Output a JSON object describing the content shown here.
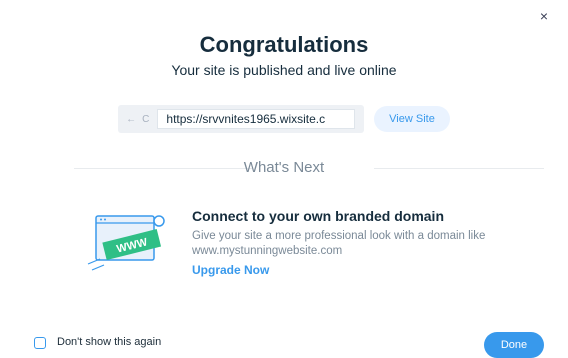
{
  "dialog": {
    "close_glyph": "×",
    "title": "Congratulations",
    "subtitle": "Your site is published and live online"
  },
  "url_bar": {
    "back_glyph": "←",
    "refresh_glyph": "C",
    "url": "https://srvvnites1965.wixsite.c",
    "view_site_label": "View Site"
  },
  "whats_next": {
    "heading": "What's Next"
  },
  "feature": {
    "illustration_text": "WWW",
    "title": "Connect to your own branded domain",
    "description_line1": "Give your site a more professional look with a domain like",
    "description_line2": "www.mystunningwebsite.com",
    "link_label": "Upgrade Now"
  },
  "footer": {
    "checkbox_label": "Don't show this again",
    "checkbox_checked": false,
    "done_label": "Done"
  },
  "colors": {
    "accent": "#3899ec",
    "accent_light": "#eaf3ff",
    "title": "#162d3d",
    "muted": "#7a8997",
    "illustration_green": "#2fbf86"
  }
}
